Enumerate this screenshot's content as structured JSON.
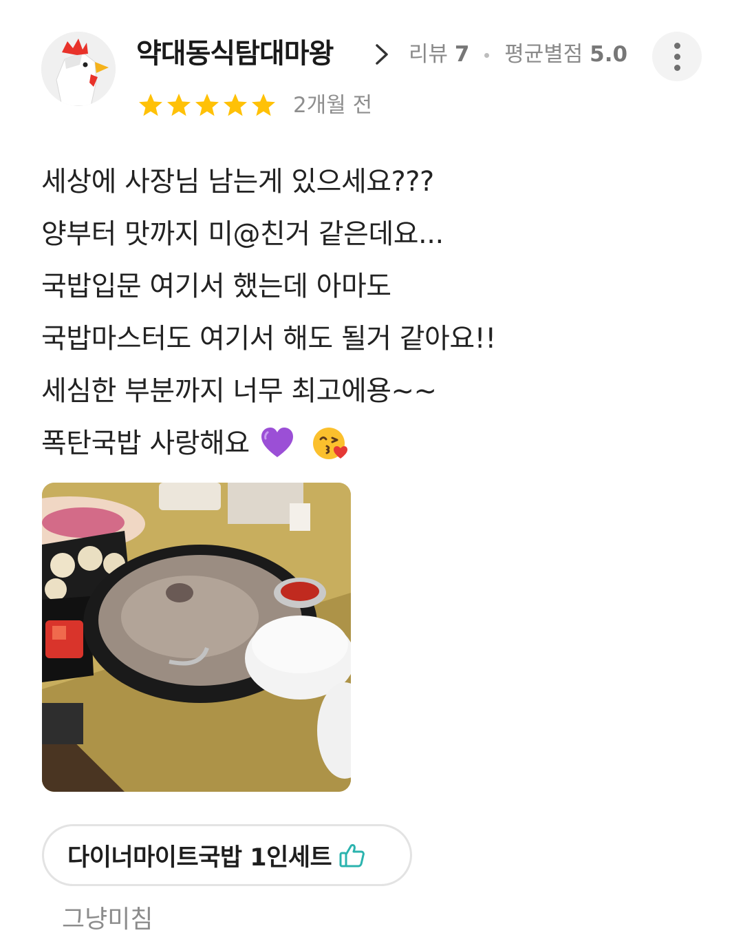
{
  "review": {
    "user": {
      "name": "약대동식탐대마왕",
      "review_count_label": "리뷰",
      "review_count": "7",
      "avg_rating_label": "평균별점",
      "avg_rating": "5.0"
    },
    "rating": 5,
    "date": "2개월 전",
    "body_lines": [
      "세상에 사장님 남는게 있으세요???",
      "양부터 맛까지 미@친거 같은데요...",
      "국밥입문 여기서 했는데 아마도",
      "국밥마스터도 여기서 해도 될거 같아요!!",
      "세심한 부분까지 너무 최고에용~~",
      "폭탄국밥 사랑해요"
    ],
    "body_emojis": [
      "purple-heart-icon",
      "kissing-face-heart-icon"
    ],
    "menu_item": "다이너마이트국밥 1인세트",
    "menu_comment": "그냥미침"
  },
  "colors": {
    "star": "#FFC107",
    "thumb": "#2BB3AE",
    "meta_text": "#8A8A8A"
  }
}
